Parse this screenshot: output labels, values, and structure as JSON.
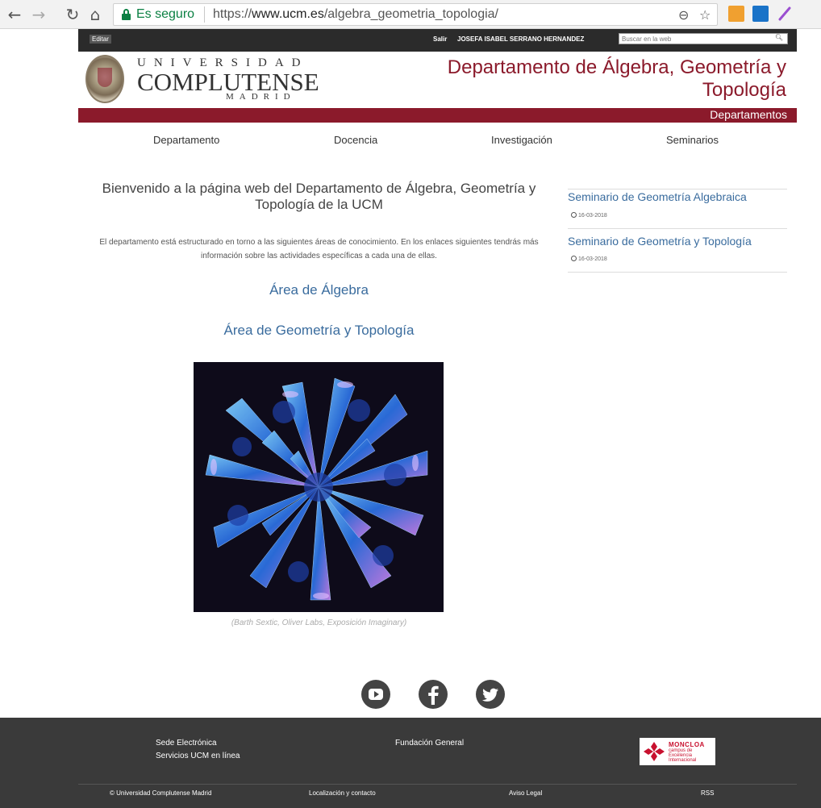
{
  "browser": {
    "secure_label": "Es seguro",
    "url_prefix": "https://",
    "url_host": "www.ucm.es",
    "url_path": "/algebra_geometria_topologia/"
  },
  "topbar": {
    "edit_label": "Editar",
    "logout_label": "Salir",
    "user_name": "JOSEFA ISABEL SERRANO HERNANDEZ",
    "search_placeholder": "Buscar en la web"
  },
  "header": {
    "univ_line": "UNIVERSIDAD",
    "complutense_line": "COMPLUTENSE",
    "madrid_line": "MADRID",
    "dept_title": "Departamento de Álgebra, Geometría y Topología",
    "section_label": "Departamentos"
  },
  "nav": {
    "items": [
      {
        "label": "Departamento"
      },
      {
        "label": "Docencia"
      },
      {
        "label": "Investigación"
      },
      {
        "label": "Seminarios"
      }
    ]
  },
  "main": {
    "welcome": "Bienvenido a la página web del Departamento de Álgebra, Geometría y Topología de la UCM",
    "intro": "El departamento está estructurado en torno a las siguientes áreas de conocimiento. En los enlaces siguientes tendrás más información sobre las actividades específicas a cada una de ellas.",
    "area_algebra": "Área de Álgebra",
    "area_geometria": "Área de Geometría y Topología",
    "caption": "(Barth Sextic, Oliver Labs, Exposición Imaginary)"
  },
  "sidebar": {
    "items": [
      {
        "title": "Seminario de Geometría Algebraica",
        "date": "16-03-2018"
      },
      {
        "title": "Seminario de Geometría y Topología",
        "date": "16-03-2018"
      }
    ]
  },
  "social": [
    "youtube-icon",
    "facebook-icon",
    "twitter-icon"
  ],
  "footer": {
    "sede": "Sede Electrónica",
    "servicios": "Servicios UCM en línea",
    "fundacion": "Fundación General",
    "copyright": "© Universidad Complutense Madrid",
    "contacto": "Localización y contacto",
    "aviso": "Aviso Legal",
    "rss": "RSS",
    "moncloa_title": "MONCLOA",
    "moncloa_line1": "campus de",
    "moncloa_line2": "Excelencia",
    "moncloa_line3": "Internacional"
  },
  "colors": {
    "brand_red": "#8b1a2b",
    "link_blue": "#3a6c9e",
    "footer_bg": "#3a3a3a",
    "topbar_bg": "#2b2b2b"
  }
}
